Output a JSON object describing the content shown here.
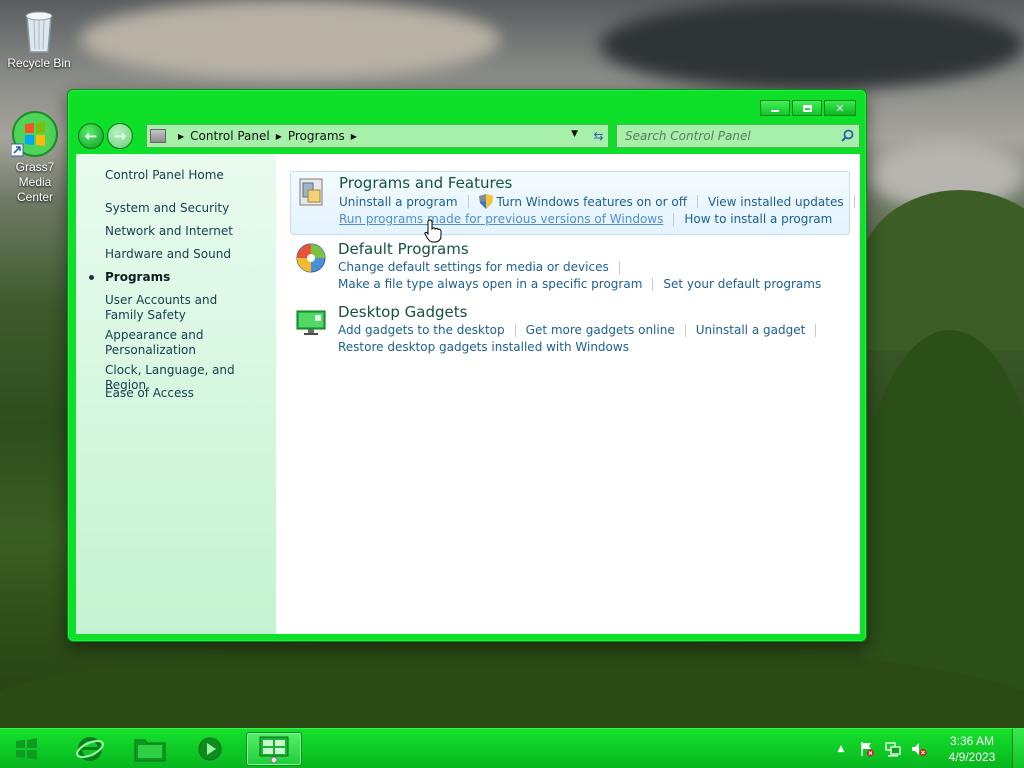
{
  "desktop": {
    "icons": [
      {
        "label": "Recycle Bin",
        "icon": "recycle-bin-icon"
      },
      {
        "label": "Grass7 Media Center",
        "icon": "windows-media-center-icon"
      }
    ]
  },
  "window": {
    "address": {
      "crumbs": [
        "Control Panel",
        "Programs"
      ]
    },
    "search": {
      "placeholder": "Search Control Panel"
    },
    "sidebar": {
      "home": "Control Panel Home",
      "items": [
        {
          "label": "System and Security"
        },
        {
          "label": "Network and Internet"
        },
        {
          "label": "Hardware and Sound"
        },
        {
          "label": "Programs",
          "current": true
        },
        {
          "label": "User Accounts and Family Safety"
        },
        {
          "label": "Appearance and Personalization"
        },
        {
          "label": "Clock, Language, and Region"
        },
        {
          "label": "Ease of Access"
        }
      ]
    },
    "categories": [
      {
        "title": "Programs and Features",
        "icon": "programs-features-icon",
        "rows": [
          [
            "Uninstall a program",
            "Turn Windows features on or off",
            "View installed updates"
          ],
          [
            "Run programs made for previous versions of Windows",
            "How to install a program"
          ]
        ]
      },
      {
        "title": "Default Programs",
        "icon": "default-programs-icon",
        "rows": [
          [
            "Change default settings for media or devices"
          ],
          [
            "Make a file type always open in a specific program",
            "Set your default programs"
          ]
        ]
      },
      {
        "title": "Desktop Gadgets",
        "icon": "desktop-gadgets-icon",
        "rows": [
          [
            "Add gadgets to the desktop",
            "Get more gadgets online",
            "Uninstall a gadget"
          ],
          [
            "Restore desktop gadgets installed with Windows"
          ]
        ]
      }
    ]
  },
  "taskbar": {
    "clock": {
      "time": "3:36 AM",
      "date": "4/9/2023"
    }
  },
  "colors": {
    "accent": "#0ee02a",
    "link": "#1d5f91",
    "title": "#14543a"
  }
}
